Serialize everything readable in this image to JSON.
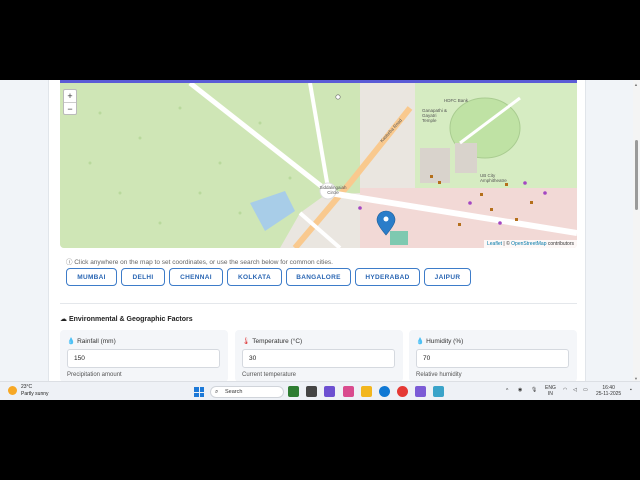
{
  "map": {
    "zoom_in": "+",
    "zoom_out": "−",
    "labels": {
      "circle": "Siddalingaiah Circle",
      "kasturba": "Kasturba Road",
      "temple": "Ganapathi & Gayatri Temple",
      "ub_city": "UB City Amphitheatre",
      "bank": "HDFC Bank"
    },
    "attribution_prefix": "Leaflet",
    "attribution_sep": "| ©",
    "attribution_link": "OpenStreetMap",
    "attribution_suffix": "contributors"
  },
  "hint": "ⓘ Click anywhere on the map to set coordinates, or use the search below for common cities.",
  "cities": [
    "MUMBAI",
    "DELHI",
    "CHENNAI",
    "KOLKATA",
    "BANGALORE",
    "HYDERABAD",
    "JAIPUR"
  ],
  "section": {
    "title": "Environmental & Geographic Factors",
    "icon": "cloud-rain-icon"
  },
  "fields": [
    {
      "icon": "💧",
      "label": "Rainfall (mm)",
      "value": "150",
      "help": "Precipitation amount"
    },
    {
      "icon": "🌡",
      "label": "Temperature (°C)",
      "value": "30",
      "help": "Current temperature"
    },
    {
      "icon": "💧",
      "label": "Humidity (%)",
      "value": "70",
      "help": "Relative humidity"
    }
  ],
  "taskbar": {
    "temp": "23°C",
    "weather": "Partly sunny",
    "search_placeholder": "Search",
    "lang_line1": "ENG",
    "lang_line2": "IN",
    "time": "16:40",
    "date": "25-11-2025"
  },
  "colors": {
    "accent": "#5b5bd6",
    "city_button": "#2a66b3",
    "park": "#cde6b2",
    "urban": "#f0e3e0",
    "marker": "#2a7dc9"
  }
}
